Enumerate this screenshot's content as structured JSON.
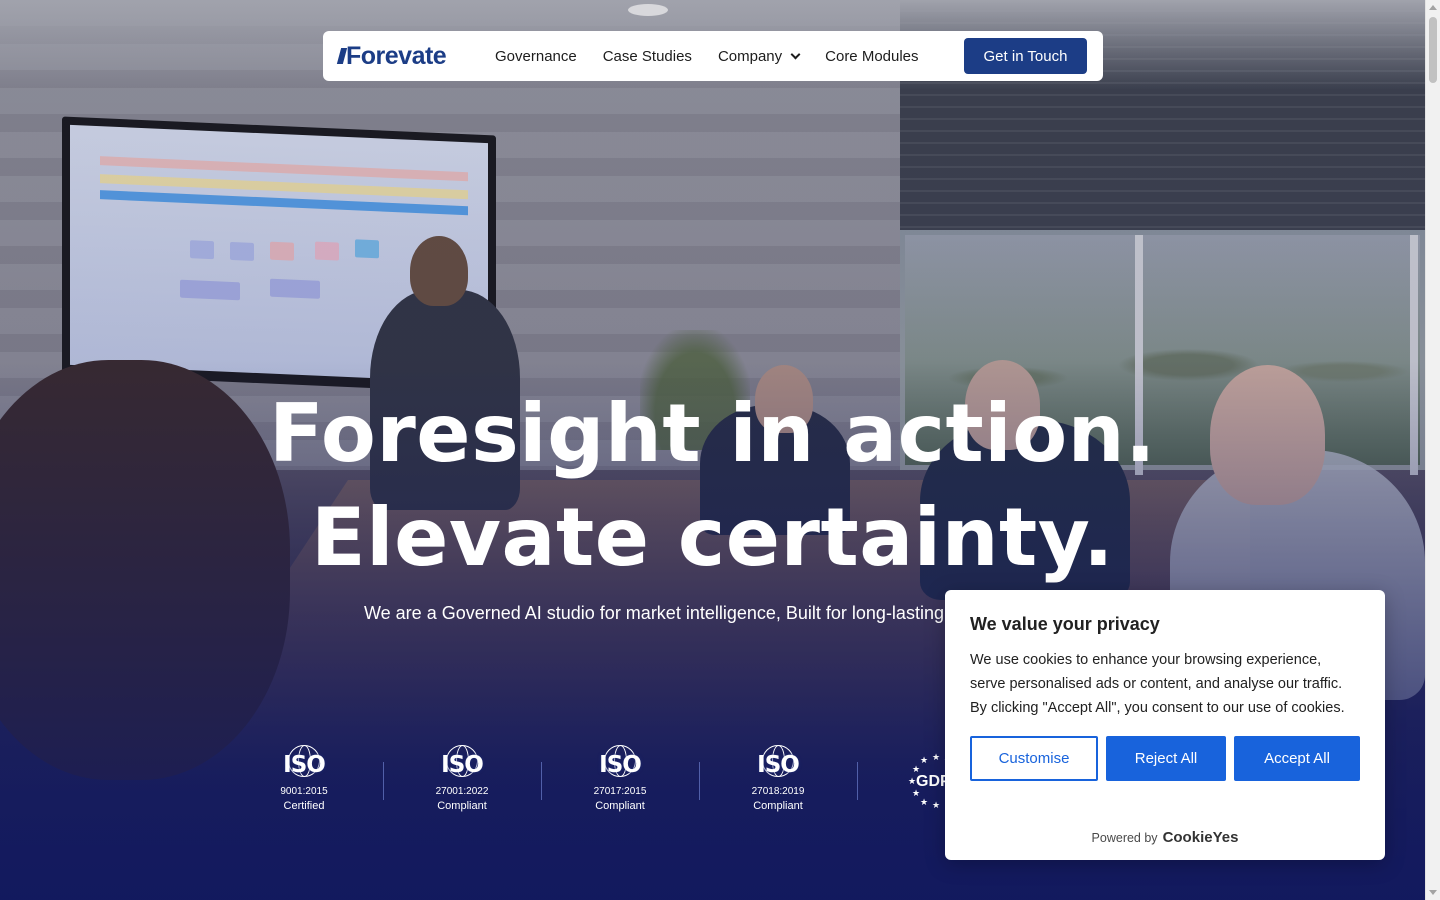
{
  "nav": {
    "logo": "Forevate",
    "items": [
      {
        "label": "Governance"
      },
      {
        "label": "Case Studies"
      },
      {
        "label": "Company",
        "has_dropdown": true
      },
      {
        "label": "Core Modules"
      }
    ],
    "cta": "Get in Touch"
  },
  "hero": {
    "headline_line1": "Foresight in action.",
    "headline_line2": "Elevate certainty.",
    "subheadline": "We are a Governed AI studio for market intelligence, Built for long-lasting"
  },
  "certifications": [
    {
      "mark": "ISO",
      "standard": "9001:2015",
      "status": "Certified"
    },
    {
      "mark": "ISO",
      "standard": "27001:2022",
      "status": "Compliant"
    },
    {
      "mark": "ISO",
      "standard": "27017:2015",
      "status": "Compliant"
    },
    {
      "mark": "ISO",
      "standard": "27018:2019",
      "status": "Compliant"
    },
    {
      "mark": "GDPR",
      "standard": "",
      "status": ""
    }
  ],
  "cookie_banner": {
    "title": "We value your privacy",
    "body": "We use cookies to enhance your browsing experience, serve personalised ads or content, and analyse our traffic. By clicking \"Accept All\", you consent to our use of cookies.",
    "customise": "Customise",
    "reject": "Reject All",
    "accept": "Accept All",
    "powered_by": "Powered by",
    "provider": "CookieYes"
  },
  "colors": {
    "brand": "#1c3d86",
    "cookie_accent": "#1863dc",
    "hero_overlay_bottom": "#171d58"
  },
  "icons": {
    "dropdown": "chevron-down-icon",
    "iso": "iso-globe-icon",
    "gdpr": "gdpr-stars-icon"
  }
}
